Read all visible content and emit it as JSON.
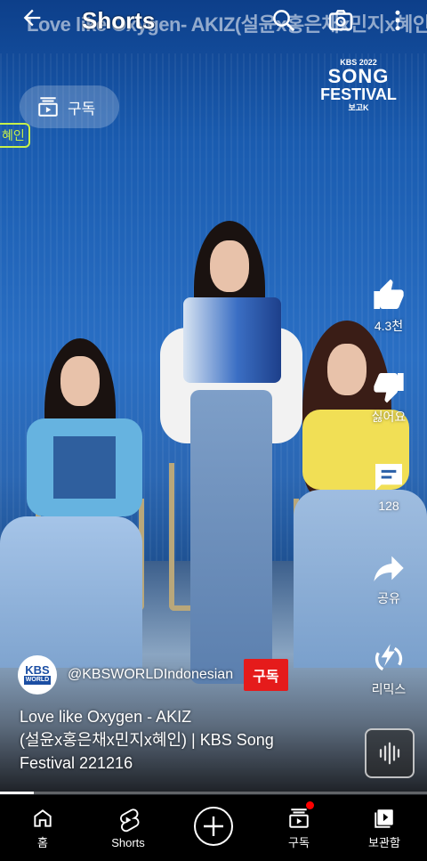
{
  "header": {
    "marquee": "Love like Oxygen- AKIZ(설윤x홍은채x민지x혜인)",
    "title": "Shorts"
  },
  "overlay": {
    "subscriptions_label": "구독",
    "song_logo_line1": "KBS 2022",
    "song_logo_line2": "SONG",
    "song_logo_line3": "FESTIVAL",
    "song_logo_line4": "보고K",
    "name_tag": "혜인"
  },
  "actions": {
    "like": "4.3천",
    "dislike": "싫어요",
    "comments": "128",
    "share": "공유",
    "remix": "리믹스"
  },
  "channel": {
    "avatar_line1": "KBS",
    "avatar_line2": "WORLD",
    "handle": "@KBSWORLDIndonesian",
    "subscribe_label": "구독"
  },
  "video": {
    "title_line1": "Love like Oxygen - AKIZ",
    "title_line2": "(설윤x홍은채x민지x혜인)  | KBS Song",
    "title_line3": "Festival 221216",
    "progress": 0.08
  },
  "nav": {
    "home": "홈",
    "shorts": "Shorts",
    "subscriptions": "구독",
    "library": "보관함"
  },
  "colors": {
    "subscribe_red": "#e51b1b",
    "accent_green": "#c7f04a",
    "notification_dot": "#ff0000"
  },
  "icons": [
    "back-arrow-icon",
    "search-icon",
    "camera-icon",
    "more-vert-icon",
    "subscriptions-icon",
    "thumb-up-icon",
    "thumb-down-icon",
    "comment-icon",
    "share-icon",
    "remix-icon",
    "sound-wave-icon",
    "home-icon",
    "shorts-icon",
    "create-plus-icon",
    "library-icon"
  ]
}
